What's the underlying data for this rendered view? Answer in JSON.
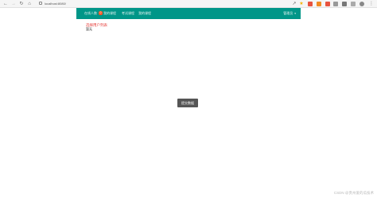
{
  "browser": {
    "url": "localhost:8080/"
  },
  "navbar": {
    "items": [
      {
        "label": "在线人数",
        "badge": "0"
      },
      {
        "label": "我的课程"
      },
      {
        "label": "考试课程"
      },
      {
        "label": "我的课程"
      }
    ],
    "user": "管理员"
  },
  "content": {
    "title": "选择用户列表",
    "subtext": "暂无"
  },
  "action_button": {
    "label": "提交数据"
  },
  "watermark": "CSDN @贵州爱的瓜技术",
  "colors": {
    "navbar": "#009688",
    "badge": "#ff5722",
    "title": "#e53935",
    "button": "#555555"
  }
}
